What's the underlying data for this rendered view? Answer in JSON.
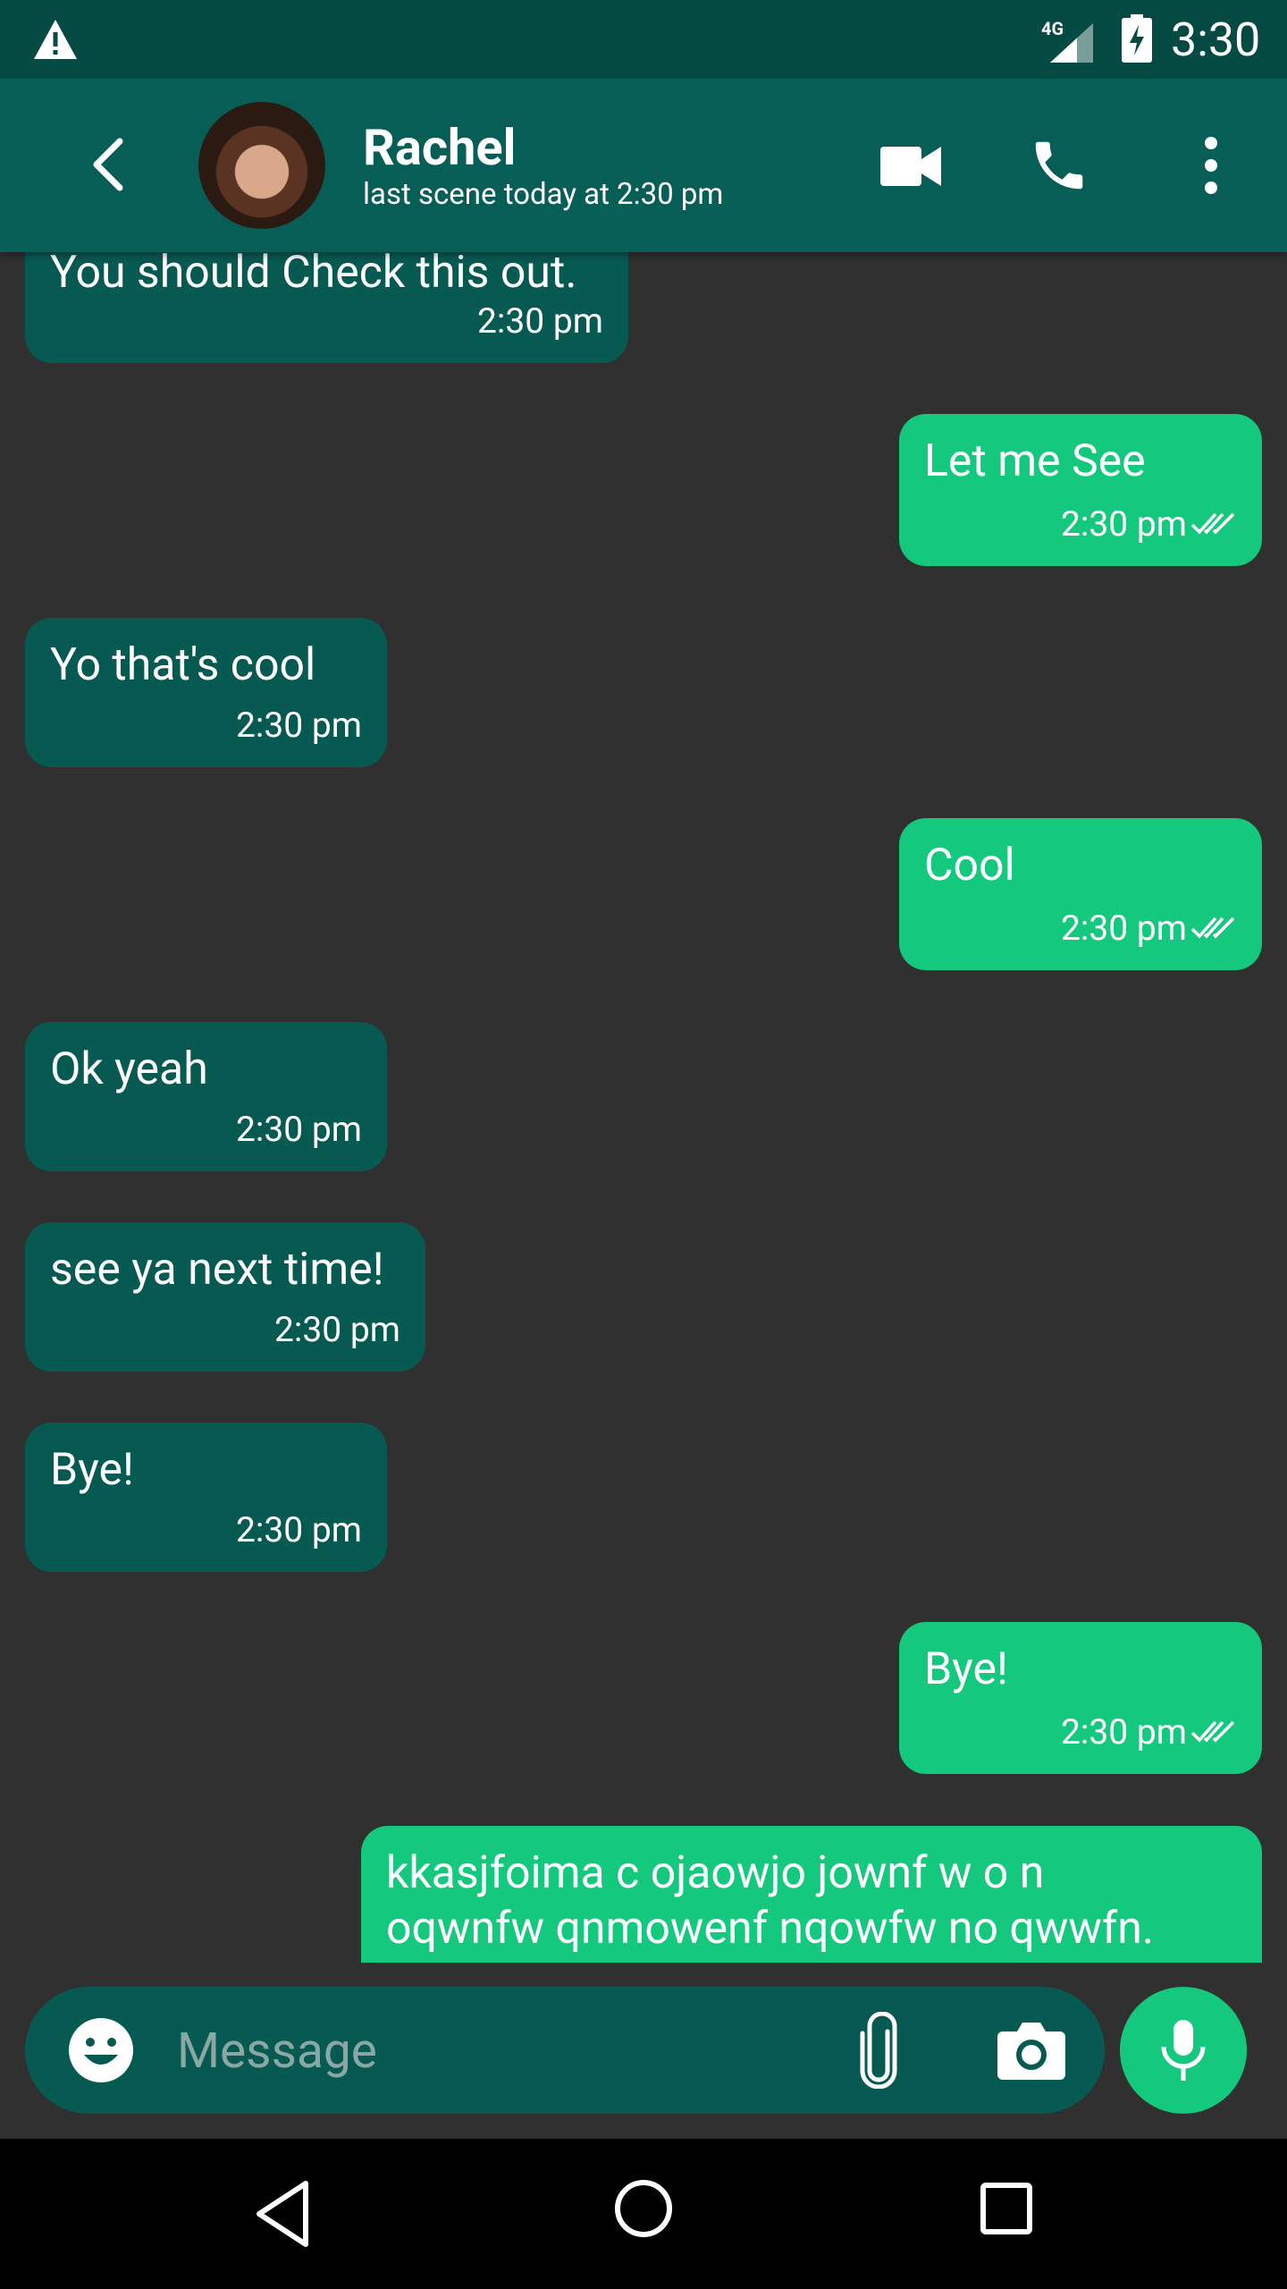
{
  "status_bar": {
    "time": "3:30",
    "network": "4G",
    "icons": [
      "warning-icon",
      "signal-icon",
      "battery-charging-icon"
    ]
  },
  "header": {
    "contact_name": "Rachel",
    "last_seen": "last scene today at 2:30 pm",
    "icons": [
      "back-arrow-icon",
      "video-camera-icon",
      "phone-icon",
      "more-vert-icon"
    ]
  },
  "messages": [
    {
      "dir": "in",
      "text": "You should Check this out.",
      "time": "2:30 pm"
    },
    {
      "dir": "out",
      "text": "Let me See",
      "time": "2:30 pm",
      "read": true
    },
    {
      "dir": "in",
      "text": "Yo that's cool",
      "time": "2:30 pm"
    },
    {
      "dir": "out",
      "text": "Cool",
      "time": "2:30 pm",
      "read": true
    },
    {
      "dir": "in",
      "text": "Ok yeah",
      "time": "2:30 pm"
    },
    {
      "dir": "in",
      "text": "see ya next time!",
      "time": "2:30 pm"
    },
    {
      "dir": "in",
      "text": "Bye!",
      "time": "2:30 pm"
    },
    {
      "dir": "out",
      "text": "Bye!",
      "time": "2:30 pm",
      "read": true
    },
    {
      "dir": "out",
      "text_lines": [
        "kkasjfoima c ojaowjo jownf w o n",
        "oqwnfw  qnmowenf   nqowfw no qwwfn."
      ]
    }
  ],
  "composer": {
    "placeholder": "Message",
    "value": "",
    "icons": [
      "emoji-icon",
      "attach-icon",
      "camera-icon",
      "mic-icon"
    ]
  },
  "nav_bar": {
    "icons": [
      "nav-back-icon",
      "nav-home-icon",
      "nav-recents-icon"
    ]
  },
  "colors": {
    "status_bar": "#064a44",
    "app_bar": "#075e56",
    "background": "#303030",
    "incoming_bubble": "#075a52",
    "outgoing_bubble": "#14c97e",
    "accent": "#14c97e"
  }
}
